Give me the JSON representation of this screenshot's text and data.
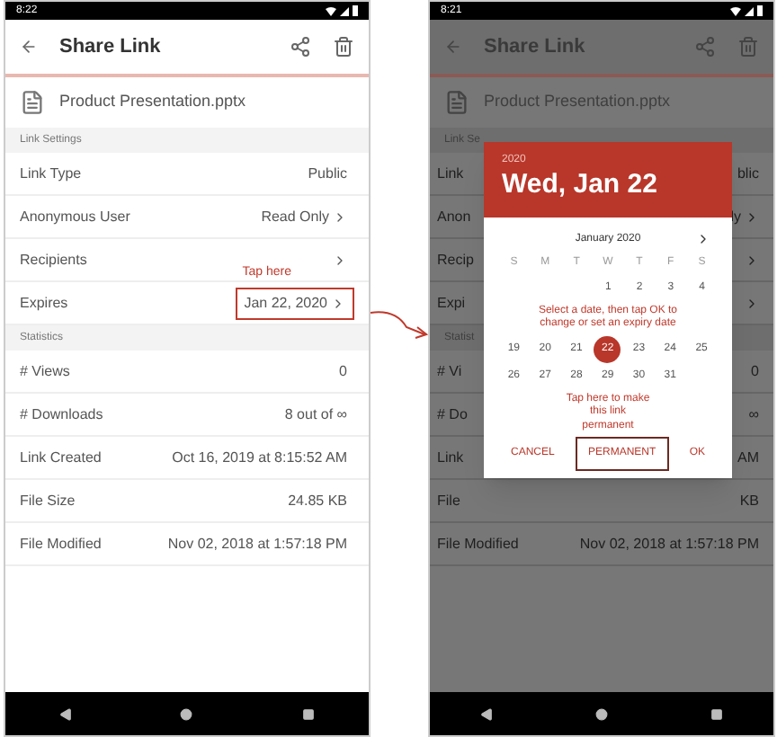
{
  "phones": [
    {
      "status_time": "8:22",
      "title": "Share Link",
      "file_name": "Product Presentation.pptx",
      "dimmed": false,
      "sections": [
        {
          "heading": "Link Settings",
          "rows": [
            {
              "label": "Link Type",
              "value": "Public",
              "chevron": false
            },
            {
              "label": "Anonymous User",
              "value": "Read Only",
              "chevron": true
            },
            {
              "label": "Recipients",
              "chevron": true
            },
            {
              "label": "Expires",
              "value": "Jan 22, 2020",
              "chevron": true,
              "note": "Tap here",
              "boxed": true
            }
          ]
        },
        {
          "heading": "Statistics",
          "rows": [
            {
              "label": "# Views",
              "value": "0",
              "chevron": false
            },
            {
              "label": "# Downloads",
              "value": "8 out of ∞",
              "chevron": false
            },
            {
              "label": "Link Created",
              "value": "Oct 16, 2019 at 8:15:52 AM",
              "chevron": false
            },
            {
              "label": "File Size",
              "value": "24.85 KB",
              "chevron": false
            },
            {
              "label": "File Modified",
              "value": "Nov 02, 2018 at 1:57:18 PM",
              "chevron": false
            }
          ]
        }
      ]
    },
    {
      "status_time": "8:21",
      "title": "Share Link",
      "file_name": "Product Presentation.pptx",
      "dimmed": true,
      "sections": [
        {
          "heading": "Link Se",
          "rows": [
            {
              "label": "Link",
              "value": "blic",
              "chevron": false
            },
            {
              "label": "Anon",
              "value": "ly",
              "chevron": true
            },
            {
              "label": "Recip",
              "chevron": true
            },
            {
              "label": "Expi",
              "chevron": true
            }
          ]
        },
        {
          "heading": "Statist",
          "rows": [
            {
              "label": "# Vi",
              "value": "0",
              "chevron": false
            },
            {
              "label": "# Do",
              "value": "∞",
              "chevron": false
            },
            {
              "label": "Link",
              "value": "AM",
              "chevron": false
            },
            {
              "label": "File",
              "value": "KB",
              "chevron": false
            },
            {
              "label": "File Modified",
              "value": "Nov 02, 2018 at 1:57:18 PM",
              "chevron": false
            }
          ]
        }
      ]
    }
  ],
  "date_picker": {
    "year": "2020",
    "date": "Wed, Jan 22",
    "month": "January 2020",
    "weekdays": [
      "S",
      "M",
      "T",
      "W",
      "T",
      "F",
      "S"
    ],
    "weeks": [
      {
        "kind": "days",
        "days": [
          {
            "day": "1",
            "selected": false
          },
          {
            "day": "2",
            "selected": false
          },
          {
            "day": "3",
            "selected": false
          },
          {
            "day": "4",
            "selected": false
          }
        ]
      },
      {
        "kind": "note",
        "text": "Select a date, then tap OK to change or set an expiry date"
      },
      {
        "kind": "days",
        "days": [
          {
            "day": "19",
            "selected": false
          },
          {
            "day": "20",
            "selected": false
          },
          {
            "day": "21",
            "selected": false
          },
          {
            "day": "22",
            "selected": true
          },
          {
            "day": "23",
            "selected": false
          },
          {
            "day": "24",
            "selected": false
          },
          {
            "day": "25",
            "selected": false
          }
        ]
      },
      {
        "kind": "days",
        "days": [
          {
            "day": "26",
            "selected": false
          },
          {
            "day": "27",
            "selected": false
          },
          {
            "day": "28",
            "selected": false
          },
          {
            "day": "29",
            "selected": false
          },
          {
            "day": "30",
            "selected": false
          },
          {
            "day": "31",
            "selected": false
          }
        ]
      }
    ],
    "button_note": "Tap here to make this link permanent",
    "buttons": [
      {
        "label": "CANCEL",
        "boxed": false
      },
      {
        "label": "PERMANENT",
        "boxed": true
      },
      {
        "label": "OK",
        "boxed": false
      }
    ]
  }
}
